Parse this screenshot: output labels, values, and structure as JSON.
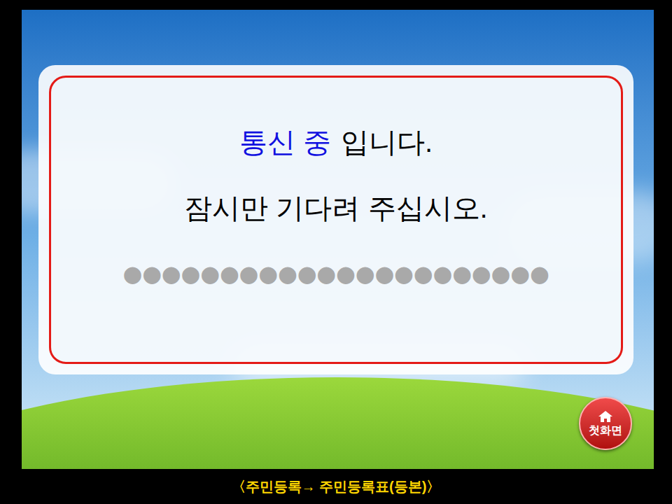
{
  "message": {
    "status": "통신 중",
    "status_suffix": "입니다.",
    "prompt": "잠시만 기다려 주십시오.",
    "dots": "●●●●●●●●●●●●●●●●●●●●●●"
  },
  "home_button": {
    "label": "첫화면"
  },
  "footer": {
    "breadcrumb": "〈주민등록→ 주민등록표(등본)〉"
  }
}
